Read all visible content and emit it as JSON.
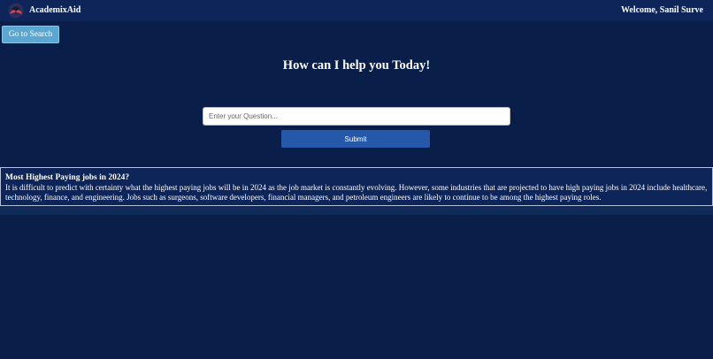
{
  "header": {
    "brand": "AcademixAid",
    "welcome": "Welcome, Sanil Surve",
    "logo_icon": "academix-logo-icon"
  },
  "nav": {
    "go_to_search": "Go to Search"
  },
  "main": {
    "headline": "How can I help you Today!",
    "question_placeholder": "Enter your Question...",
    "submit_label": "Submit"
  },
  "answer": {
    "title": "Most Highest Paying jobs in 2024?",
    "lines": [
      "It is difficult to predict with certainty what the highest paying jobs will be in 2024 as the job market is constantly evolving. However, some industries that are projected to have high paying jobs in 2024 include healthcare,",
      "technology, finance, and engineering. Jobs such as surgeons, software developers, financial managers, and petroleum engineers are likely to continue to be among the highest paying roles."
    ]
  },
  "colors": {
    "background": "#0a1e4a",
    "navbar": "#0d2558",
    "search_button": "#5aa7d3",
    "submit_button": "#2558a9",
    "text": "#ffffff"
  }
}
